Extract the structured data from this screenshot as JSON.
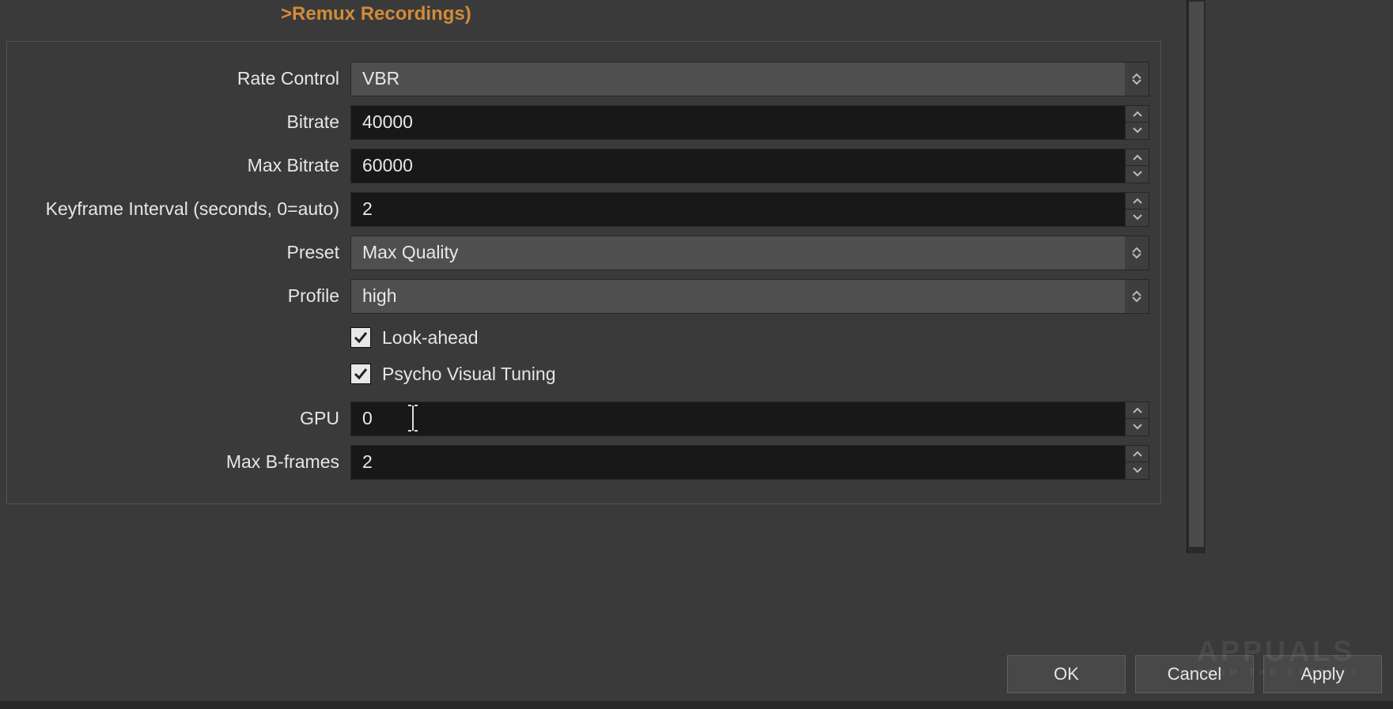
{
  "header": {
    "partial_link": ">Remux Recordings)"
  },
  "form": {
    "rate_control": {
      "label": "Rate Control",
      "value": "VBR"
    },
    "bitrate": {
      "label": "Bitrate",
      "value": "40000"
    },
    "max_bitrate": {
      "label": "Max Bitrate",
      "value": "60000"
    },
    "keyframe": {
      "label": "Keyframe Interval (seconds, 0=auto)",
      "value": "2"
    },
    "preset": {
      "label": "Preset",
      "value": "Max Quality"
    },
    "profile": {
      "label": "Profile",
      "value": "high"
    },
    "look_ahead": {
      "label": "Look-ahead",
      "checked": true
    },
    "psycho_visual": {
      "label": "Psycho Visual Tuning",
      "checked": true
    },
    "gpu": {
      "label": "GPU",
      "value": "0"
    },
    "max_bframes": {
      "label": "Max B-frames",
      "value": "2"
    }
  },
  "buttons": {
    "ok": "OK",
    "cancel": "Cancel",
    "apply": "Apply"
  },
  "watermark": {
    "brand": "APPUALS",
    "tagline": "FROM THE EXPERTS"
  }
}
